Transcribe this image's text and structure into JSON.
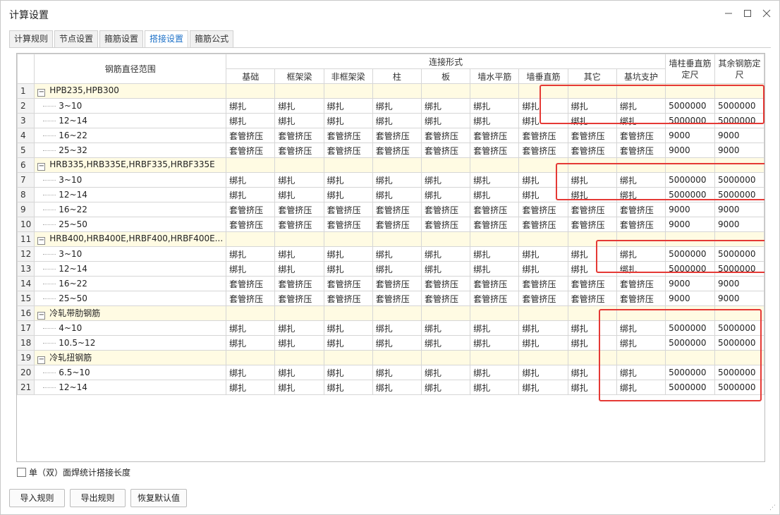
{
  "window": {
    "title": "计算设置",
    "minimize_icon": "minimize-icon",
    "maximize_icon": "maximize-icon",
    "close_icon": "close-icon"
  },
  "tabs": [
    {
      "label": "计算规则",
      "active": false
    },
    {
      "label": "节点设置",
      "active": false
    },
    {
      "label": "箍筋设置",
      "active": false
    },
    {
      "label": "搭接设置",
      "active": true
    },
    {
      "label": "箍筋公式",
      "active": false
    }
  ],
  "grid": {
    "headers": {
      "diameter": "钢筋直径范围",
      "connection": "连接形式",
      "wall_vertical": "墙柱垂直筋定尺",
      "other_fixed": "其余钢筋定尺",
      "sub": [
        "基础",
        "框架梁",
        "非框架梁",
        "柱",
        "板",
        "墙水平筋",
        "墙垂直筋",
        "其它",
        "基坑支护"
      ]
    },
    "rows": [
      {
        "n": "1",
        "group": true,
        "label": "HPB235,HPB300",
        "cells": []
      },
      {
        "n": "2",
        "group": false,
        "label": "3~10",
        "cells": [
          "绑扎",
          "绑扎",
          "绑扎",
          "绑扎",
          "绑扎",
          "绑扎",
          "绑扎",
          "绑扎",
          "绑扎",
          "5000000",
          "5000000"
        ]
      },
      {
        "n": "3",
        "group": false,
        "label": "12~14",
        "cells": [
          "绑扎",
          "绑扎",
          "绑扎",
          "绑扎",
          "绑扎",
          "绑扎",
          "绑扎",
          "绑扎",
          "绑扎",
          "5000000",
          "5000000"
        ]
      },
      {
        "n": "4",
        "group": false,
        "label": "16~22",
        "cells": [
          "套管挤压",
          "套管挤压",
          "套管挤压",
          "套管挤压",
          "套管挤压",
          "套管挤压",
          "套管挤压",
          "套管挤压",
          "套管挤压",
          "9000",
          "9000"
        ]
      },
      {
        "n": "5",
        "group": false,
        "label": "25~32",
        "cells": [
          "套管挤压",
          "套管挤压",
          "套管挤压",
          "套管挤压",
          "套管挤压",
          "套管挤压",
          "套管挤压",
          "套管挤压",
          "套管挤压",
          "9000",
          "9000"
        ]
      },
      {
        "n": "6",
        "group": true,
        "label": "HRB335,HRB335E,HRBF335,HRBF335E",
        "cells": []
      },
      {
        "n": "7",
        "group": false,
        "label": "3~10",
        "cells": [
          "绑扎",
          "绑扎",
          "绑扎",
          "绑扎",
          "绑扎",
          "绑扎",
          "绑扎",
          "绑扎",
          "绑扎",
          "5000000",
          "5000000"
        ]
      },
      {
        "n": "8",
        "group": false,
        "label": "12~14",
        "cells": [
          "绑扎",
          "绑扎",
          "绑扎",
          "绑扎",
          "绑扎",
          "绑扎",
          "绑扎",
          "绑扎",
          "绑扎",
          "5000000",
          "5000000"
        ]
      },
      {
        "n": "9",
        "group": false,
        "label": "16~22",
        "cells": [
          "套管挤压",
          "套管挤压",
          "套管挤压",
          "套管挤压",
          "套管挤压",
          "套管挤压",
          "套管挤压",
          "套管挤压",
          "套管挤压",
          "9000",
          "9000"
        ]
      },
      {
        "n": "10",
        "group": false,
        "label": "25~50",
        "cells": [
          "套管挤压",
          "套管挤压",
          "套管挤压",
          "套管挤压",
          "套管挤压",
          "套管挤压",
          "套管挤压",
          "套管挤压",
          "套管挤压",
          "9000",
          "9000"
        ]
      },
      {
        "n": "11",
        "group": true,
        "label": "HRB400,HRB400E,HRBF400,HRBF400E...",
        "cells": []
      },
      {
        "n": "12",
        "group": false,
        "label": "3~10",
        "cells": [
          "绑扎",
          "绑扎",
          "绑扎",
          "绑扎",
          "绑扎",
          "绑扎",
          "绑扎",
          "绑扎",
          "绑扎",
          "5000000",
          "5000000"
        ]
      },
      {
        "n": "13",
        "group": false,
        "label": "12~14",
        "cells": [
          "绑扎",
          "绑扎",
          "绑扎",
          "绑扎",
          "绑扎",
          "绑扎",
          "绑扎",
          "绑扎",
          "绑扎",
          "5000000",
          "5000000"
        ]
      },
      {
        "n": "14",
        "group": false,
        "label": "16~22",
        "cells": [
          "套管挤压",
          "套管挤压",
          "套管挤压",
          "套管挤压",
          "套管挤压",
          "套管挤压",
          "套管挤压",
          "套管挤压",
          "套管挤压",
          "9000",
          "9000"
        ]
      },
      {
        "n": "15",
        "group": false,
        "label": "25~50",
        "cells": [
          "套管挤压",
          "套管挤压",
          "套管挤压",
          "套管挤压",
          "套管挤压",
          "套管挤压",
          "套管挤压",
          "套管挤压",
          "套管挤压",
          "9000",
          "9000"
        ]
      },
      {
        "n": "16",
        "group": true,
        "label": "冷轧带肋钢筋",
        "cells": []
      },
      {
        "n": "17",
        "group": false,
        "label": "4~10",
        "cells": [
          "绑扎",
          "绑扎",
          "绑扎",
          "绑扎",
          "绑扎",
          "绑扎",
          "绑扎",
          "绑扎",
          "绑扎",
          "5000000",
          "5000000"
        ]
      },
      {
        "n": "18",
        "group": false,
        "label": "10.5~12",
        "cells": [
          "绑扎",
          "绑扎",
          "绑扎",
          "绑扎",
          "绑扎",
          "绑扎",
          "绑扎",
          "绑扎",
          "绑扎",
          "5000000",
          "5000000"
        ]
      },
      {
        "n": "19",
        "group": true,
        "label": "冷轧扭钢筋",
        "cells": []
      },
      {
        "n": "20",
        "group": false,
        "label": "6.5~10",
        "cells": [
          "绑扎",
          "绑扎",
          "绑扎",
          "绑扎",
          "绑扎",
          "绑扎",
          "绑扎",
          "绑扎",
          "绑扎",
          "5000000",
          "5000000"
        ]
      },
      {
        "n": "21",
        "group": false,
        "label": "12~14",
        "cells": [
          "绑扎",
          "绑扎",
          "绑扎",
          "绑扎",
          "绑扎",
          "绑扎",
          "绑扎",
          "绑扎",
          "绑扎",
          "5000000",
          "5000000"
        ]
      }
    ]
  },
  "footer": {
    "checkbox_label": "单（双）面焊统计搭接长度",
    "checkbox_checked": false,
    "buttons": [
      "导入规则",
      "导出规则",
      "恢复默认值"
    ]
  },
  "colors": {
    "highlight": "#e53935",
    "group_row": "#fffbe3",
    "active_tab": "#1f72c8"
  }
}
